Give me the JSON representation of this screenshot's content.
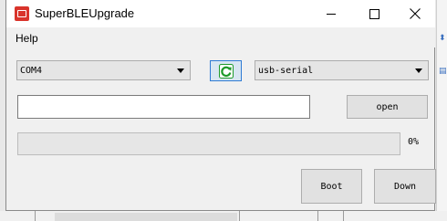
{
  "window": {
    "title": "SuperBLEUpgrade"
  },
  "menu": {
    "help_label": "Help"
  },
  "port": {
    "selected": "COM4"
  },
  "transport": {
    "selected": "usb-serial"
  },
  "file_path": {
    "value": "",
    "placeholder": ""
  },
  "buttons": {
    "open_label": "open",
    "boot_label": "Boot",
    "down_label": "Down"
  },
  "progress": {
    "fraction": 0,
    "label": "0%"
  },
  "icons": {
    "app": "app-icon",
    "refresh": "refresh-icon",
    "minimize": "minimize-icon",
    "maximize": "maximize-icon",
    "close": "close-icon"
  },
  "colors": {
    "refresh_border": "#2f7bd4",
    "refresh_arrow": "#1e9a2a",
    "progress_fill": "#06b025"
  }
}
